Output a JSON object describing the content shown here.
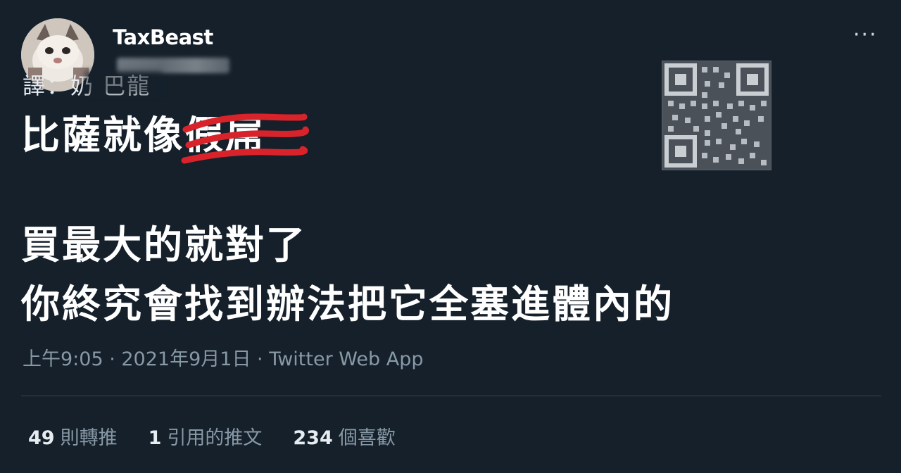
{
  "tweet": {
    "username": "TaxBeast",
    "more_label": "···",
    "translator_label": "譯：",
    "translator_name": "奶 巴龍",
    "line1_prefix": "比薩就像",
    "line1_struck": "假屌",
    "line2": "買最大的就對了",
    "line3": "你終究會找到辦法把它全塞進體內的",
    "meta": "上午9:05 · 2021年9月1日 · Twitter Web App"
  },
  "stats": {
    "retweets_count": "49",
    "retweets_label": "則轉推",
    "quotes_count": "1",
    "quotes_label": "引用的推文",
    "likes_count": "234",
    "likes_label": "個喜歡"
  },
  "colors": {
    "background": "#15202b",
    "strike": "#d9232b",
    "secondary_text": "#8899a6"
  },
  "icons": [
    "more-options-icon",
    "qr-code-icon"
  ]
}
